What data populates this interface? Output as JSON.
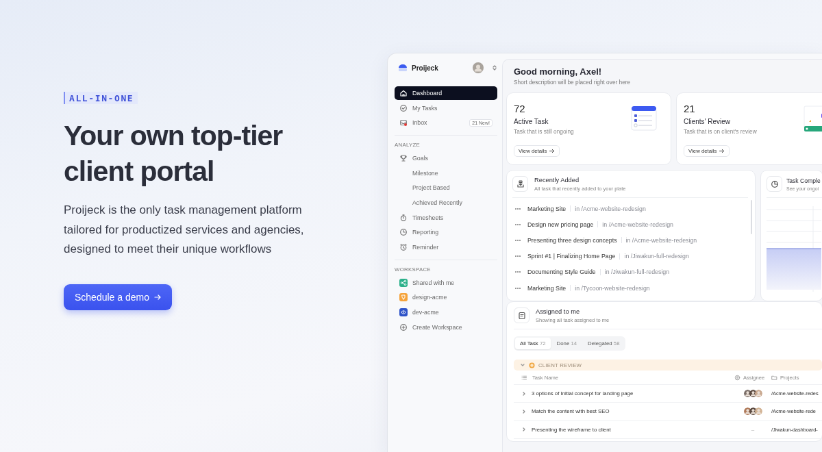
{
  "hero": {
    "eyebrow": "ALL-IN-ONE",
    "title": "Your own top-tier client portal",
    "description": "Proijeck is the only task management platform tailored for productized services and agencies, designed to meet their unique workflows",
    "button": "Schedule a demo"
  },
  "app": {
    "sidebar": {
      "brand": "Proijeck",
      "nav": [
        {
          "label": "Dashboard",
          "selected": true
        },
        {
          "label": "My Tasks",
          "selected": false
        },
        {
          "label": "Inbox",
          "selected": false,
          "unread": true,
          "badge": "21 New!"
        }
      ],
      "sections": [
        {
          "heading": "ANALYZE",
          "items": [
            {
              "label": "Goals",
              "selected": false,
              "children": [
                {
                  "label": "Milestone",
                  "selected": false
                },
                {
                  "label": "Project Based",
                  "selected": false
                },
                {
                  "label": "Achieved Recently",
                  "selected": false
                }
              ]
            },
            {
              "label": "Timesheets",
              "selected": false
            },
            {
              "label": "Reporting",
              "selected": false
            },
            {
              "label": "Reminder",
              "selected": false
            }
          ]
        },
        {
          "heading": "WORKSPACE",
          "items": [
            {
              "label": "Shared with me",
              "selected": false,
              "color": "#2bb08a"
            },
            {
              "label": "design-acme",
              "selected": false,
              "color": "#f5a33b"
            },
            {
              "label": "dev-acme",
              "selected": false,
              "color": "#2f54c8"
            },
            {
              "label": "Create Workspace",
              "selected": false
            }
          ]
        }
      ]
    },
    "greeting": {
      "title": "Good morning, Axel!",
      "subtitle": "Short description will be placed right over here"
    },
    "stats": [
      {
        "value": "72",
        "label": "Active Task",
        "description": "Task that is still ongoing",
        "button": "View details"
      },
      {
        "value": "21",
        "label": "Clients' Review",
        "description": "Task that is on client's review",
        "button": "View details"
      }
    ],
    "recently_added": {
      "title": "Recently Added",
      "subtitle": "All task that recently added to your plate",
      "items": [
        {
          "title": "Marketing Site",
          "project": "in /Acme-website-redesign"
        },
        {
          "title": "Design new pricing page",
          "project": "in /Acme-website-redesign"
        },
        {
          "title": "Presenting three design concepts",
          "project": "in /Acme-website-redesign"
        },
        {
          "title": "Sprint #1 | Finalizing Home Page",
          "project": "in /Jiwakun-full-redesign"
        },
        {
          "title": "Documenting Style Guide",
          "project": "in /Jiwakun-full-redesign"
        },
        {
          "title": "Marketing Site",
          "project": "in /Tycoon-website-redesign"
        }
      ]
    },
    "task_completion": {
      "title": "Task Comple",
      "subtitle": "See your ongoi"
    },
    "assigned": {
      "title": "Assigned to me",
      "subtitle": "Showing all task assigned to me",
      "tabs": [
        {
          "label": "All Task",
          "count": "72",
          "selected": true
        },
        {
          "label": "Done",
          "count": "14",
          "selected": false
        },
        {
          "label": "Delegated",
          "count": "58",
          "selected": false
        }
      ],
      "group": {
        "label": "CLIENT REVIEW",
        "expanded": true
      },
      "columns": [
        "Task Name",
        "Assignee",
        "Projects"
      ],
      "rows": [
        {
          "task": "3 options of Initial concept for landing page",
          "assignees": [
            {
              "color": "#7a6e68"
            },
            {
              "color": "#5b4a40"
            },
            {
              "color": "#c9a88f"
            }
          ],
          "project": "/Acme-website-redes"
        },
        {
          "task": "Match the content with best SEO",
          "assignees": [
            {
              "color": "#b07a5a"
            },
            {
              "color": "#5b4a40"
            },
            {
              "color": "#d2b394"
            }
          ],
          "project": "/Acme-website-rede"
        },
        {
          "task": "Presenting the wireframe to client",
          "assignee_text": "–",
          "project": "/Jiwakun-dashboard-"
        }
      ]
    }
  }
}
